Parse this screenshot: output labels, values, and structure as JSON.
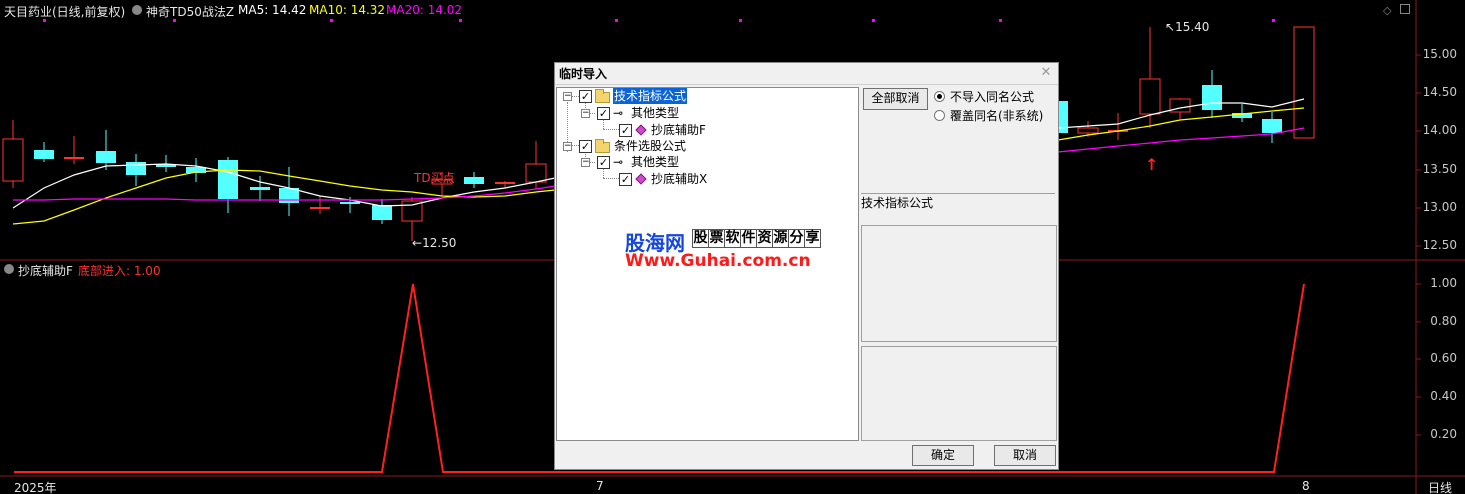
{
  "header": {
    "stock": "天目药业(日线,前复权)",
    "indicator": "神奇TD50战法Z",
    "ma5_label": "MA5: 14.42",
    "ma10_label": "MA10: 14.32",
    "ma20_label": "MA20: 14.02"
  },
  "price_axis": [
    "15.00",
    "14.50",
    "14.00",
    "13.50",
    "13.00",
    "12.50"
  ],
  "price_annotations": {
    "high": "15.40",
    "low": "12.50",
    "signal_text": "TD买点"
  },
  "sub_header": {
    "name": "抄底辅助F",
    "value_label": "底部进入: 1.00"
  },
  "sub_axis": [
    "1.00",
    "0.80",
    "0.60",
    "0.40",
    "0.20"
  ],
  "time_axis": {
    "year": "2025年",
    "mid": "7",
    "right": "8",
    "period": "日线"
  },
  "colors": {
    "up_candle": "#ff3232",
    "down_candle": "#54ffff",
    "ma5": "#ffffff",
    "ma10": "#ffff00",
    "ma20": "#ff00ff",
    "sub_line": "#ff2020"
  },
  "dialog": {
    "title": "临时导入",
    "close_icon": "close-icon",
    "tree": {
      "root1": "技术指标公式",
      "root1_child": "其他类型",
      "root1_leaf": "抄底辅助F",
      "root2": "条件选股公式",
      "root2_child": "其他类型",
      "root2_leaf": "抄底辅助X"
    },
    "cancel_all_button": "全部取消",
    "radio_option_1": "不导入同名公式",
    "radio_option_2": "覆盖同名(非系统)",
    "info_label": "技术指标公式",
    "ok_button": "确定",
    "cancel_button": "取消"
  },
  "watermark": {
    "site_name": "股海网",
    "slogan_chars": [
      "股",
      "票",
      "软",
      "件",
      "资",
      "源",
      "分",
      "享"
    ],
    "url": "Www.Guhai.com.cn"
  }
}
